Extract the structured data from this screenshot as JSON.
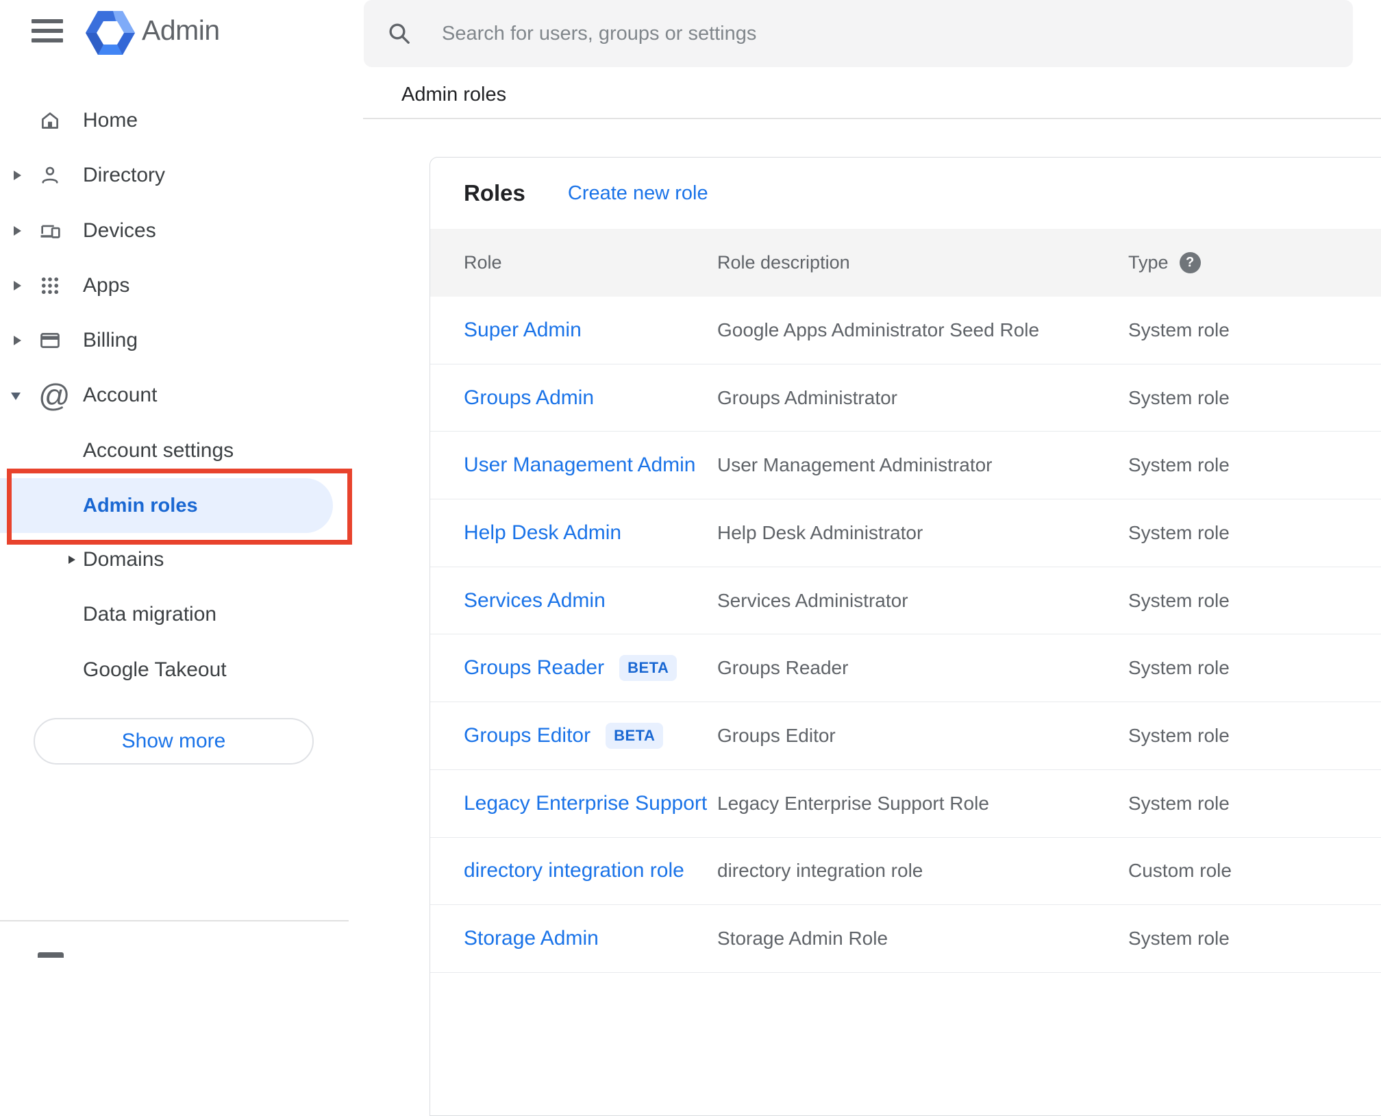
{
  "colors": {
    "accent_blue": "#1a73e8",
    "selected_blue": "#1967d2",
    "annotation_red": "#e8432d",
    "badge_bg": "#e8f0fe",
    "icon_gray": "#5f6368"
  },
  "header": {
    "app_title": "Admin"
  },
  "search": {
    "placeholder": "Search for users, groups or settings"
  },
  "breadcrumb": "Admin roles",
  "sidebar": {
    "items": [
      {
        "label": "Home",
        "icon": "home-icon",
        "expandable": false
      },
      {
        "label": "Directory",
        "icon": "person-icon",
        "expandable": true
      },
      {
        "label": "Devices",
        "icon": "devices-icon",
        "expandable": true
      },
      {
        "label": "Apps",
        "icon": "apps-grid-icon",
        "expandable": true
      },
      {
        "label": "Billing",
        "icon": "credit-card-icon",
        "expandable": true
      },
      {
        "label": "Account",
        "icon": "at-sign-icon",
        "expandable": true,
        "expanded": true
      }
    ],
    "account_children": [
      {
        "label": "Account settings"
      },
      {
        "label": "Admin roles",
        "selected": true,
        "annotated": true
      },
      {
        "label": "Domains",
        "expandable": true
      },
      {
        "label": "Data migration"
      },
      {
        "label": "Google Takeout"
      }
    ],
    "show_more_label": "Show more"
  },
  "content": {
    "card_title": "Roles",
    "create_link": "Create new role",
    "columns": {
      "role": "Role",
      "description": "Role description",
      "type": "Type"
    },
    "help_glyph": "?",
    "beta_label": "BETA",
    "rows": [
      {
        "role": "Super Admin",
        "beta": false,
        "description": "Google Apps Administrator Seed Role",
        "type": "System role"
      },
      {
        "role": "Groups Admin",
        "beta": false,
        "description": "Groups Administrator",
        "type": "System role"
      },
      {
        "role": "User Management Admin",
        "beta": false,
        "description": "User Management Administrator",
        "type": "System role"
      },
      {
        "role": "Help Desk Admin",
        "beta": false,
        "description": "Help Desk Administrator",
        "type": "System role"
      },
      {
        "role": "Services Admin",
        "beta": false,
        "description": "Services Administrator",
        "type": "System role"
      },
      {
        "role": "Groups Reader",
        "beta": true,
        "description": "Groups Reader",
        "type": "System role"
      },
      {
        "role": "Groups Editor",
        "beta": true,
        "description": "Groups Editor",
        "type": "System role"
      },
      {
        "role": "Legacy Enterprise Support",
        "beta": false,
        "description": "Legacy Enterprise Support Role",
        "type": "System role"
      },
      {
        "role": "directory integration role",
        "beta": false,
        "description": "directory integration role",
        "type": "Custom role"
      },
      {
        "role": "Storage Admin",
        "beta": false,
        "description": "Storage Admin Role",
        "type": "System role"
      }
    ]
  }
}
